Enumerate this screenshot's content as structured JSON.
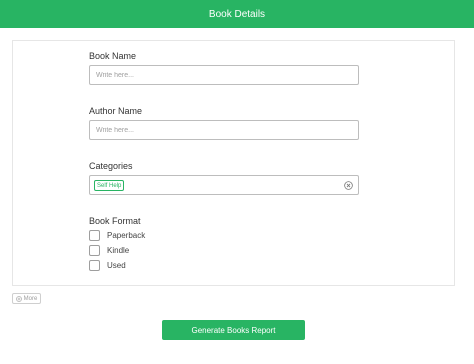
{
  "header": {
    "title": "Book Details"
  },
  "form": {
    "book_name": {
      "label": "Book Name",
      "placeholder": "Write here..."
    },
    "author_name": {
      "label": "Author Name",
      "placeholder": "Write here..."
    },
    "categories": {
      "label": "Categories",
      "tags": [
        "Self Help"
      ],
      "clear_icon": "clear-circle-icon"
    },
    "book_format": {
      "label": "Book Format",
      "options": [
        {
          "label": "Paperback",
          "checked": false
        },
        {
          "label": "Kindle",
          "checked": false
        },
        {
          "label": "Used",
          "checked": false
        }
      ]
    }
  },
  "more_button": {
    "label": "More",
    "icon": "plus-circle-icon"
  },
  "generate_button": {
    "label": "Generate Books Report"
  },
  "colors": {
    "accent": "#28b463",
    "border": "#bdbdbd"
  }
}
